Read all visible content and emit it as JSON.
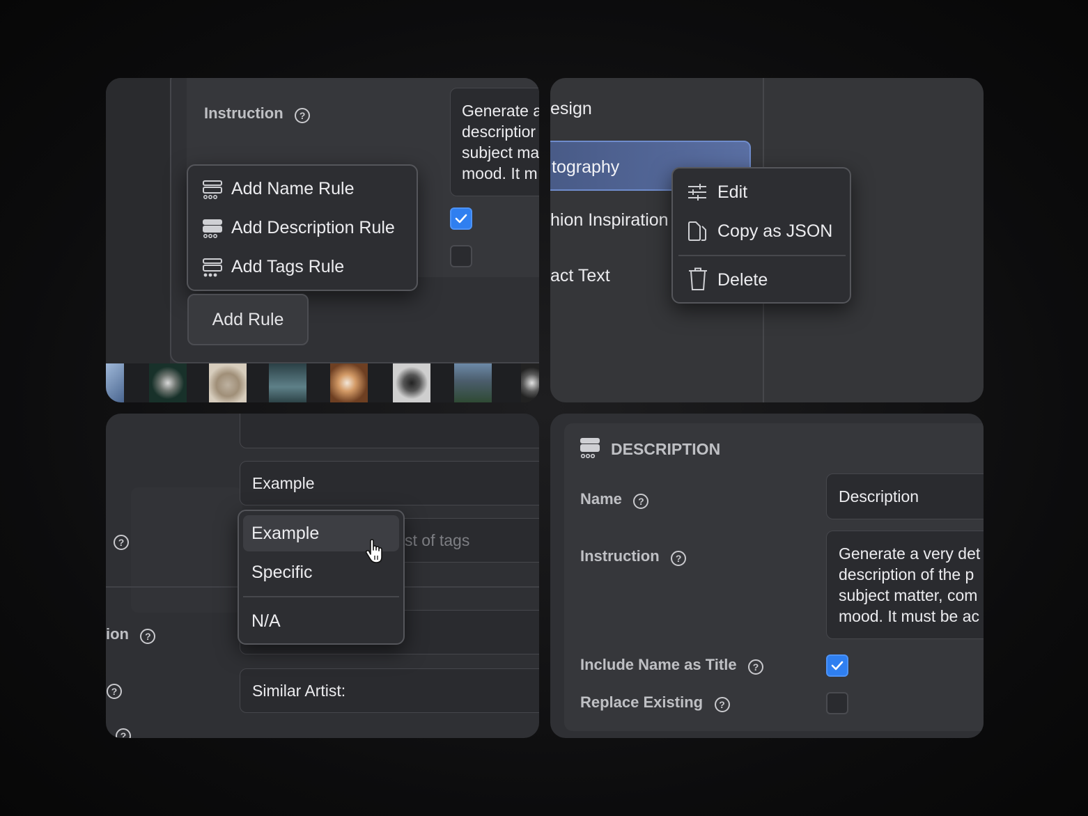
{
  "p1": {
    "instruction_label": "Instruction",
    "instruction_lines": [
      "Generate a",
      "descriptior",
      "subject ma",
      "mood. It m"
    ],
    "menu": [
      "Add Name Rule",
      "Add Description Rule",
      "Add Tags Rule"
    ],
    "add_rule": "Add Rule",
    "checkbox1_checked": true,
    "checkbox2_checked": false
  },
  "p2": {
    "list": [
      "esign",
      "tography",
      "hion Inspiration",
      "act Text"
    ],
    "context_menu": [
      "Edit",
      "Copy as JSON",
      "Delete"
    ],
    "icons": [
      "sliders-icon",
      "copy-icon",
      "trash-icon"
    ]
  },
  "p3": {
    "example_value": "Example",
    "tags_placeholder": "st of tags",
    "dropdown_options": [
      "Example",
      "Specific",
      "N/A"
    ],
    "label_fragment": "ion",
    "similar_artist_value": "Similar Artist:"
  },
  "p4": {
    "section_title": "DESCRIPTION",
    "name_label": "Name",
    "name_value": "Description",
    "instruction_label": "Instruction",
    "instruction_lines": [
      "Generate a very det",
      "description of the p",
      "subject matter, com",
      "mood. It must be ac"
    ],
    "include_label": "Include Name as Title",
    "include_checked": true,
    "replace_label": "Replace Existing",
    "replace_checked": false
  },
  "colors": {
    "accent": "#2f7ff0",
    "panel": "#313236",
    "field": "#2a2b2f"
  }
}
